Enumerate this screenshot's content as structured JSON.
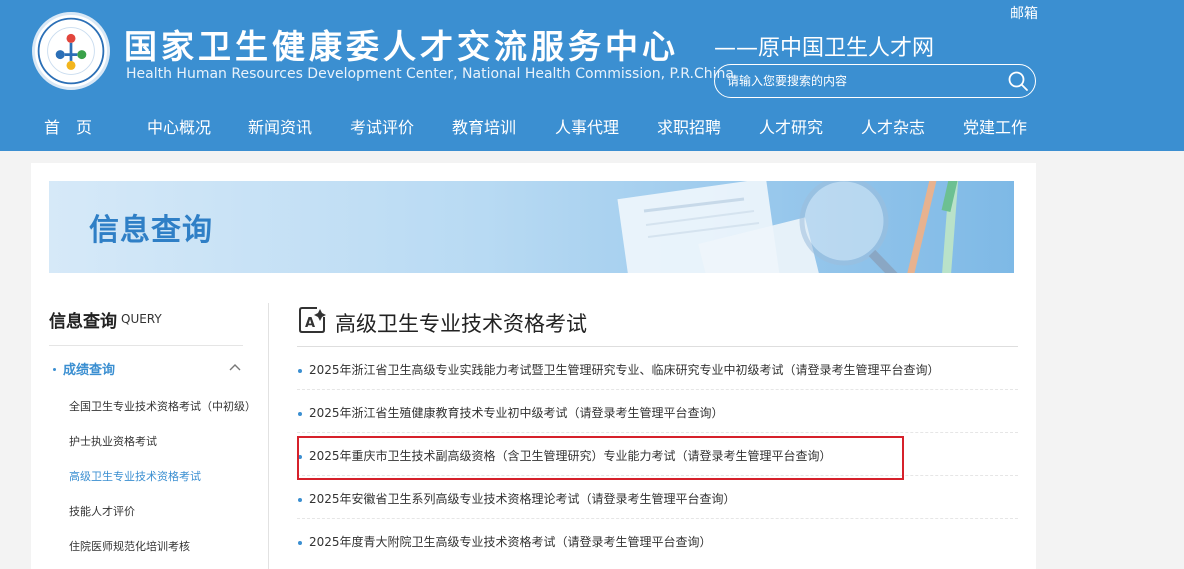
{
  "header": {
    "title": "国家卫生健康委人才交流服务中心",
    "subtitle_en": "Health Human Resources Development Center, National Health Commission, P.R.China",
    "slogan": "——原中国卫生人才网",
    "mail_label": "邮箱",
    "search": {
      "placeholder": "请输入您要搜索的内容",
      "value": ""
    }
  },
  "nav": {
    "items": [
      {
        "label": "首　页"
      },
      {
        "label": "中心概况"
      },
      {
        "label": "新闻资讯"
      },
      {
        "label": "考试评价"
      },
      {
        "label": "教育培训"
      },
      {
        "label": "人事代理"
      },
      {
        "label": "求职招聘"
      },
      {
        "label": "人才研究"
      },
      {
        "label": "人才杂志"
      },
      {
        "label": "党建工作"
      }
    ]
  },
  "banner": {
    "title": "信息查询"
  },
  "sidebar": {
    "title": "信息查询",
    "title_en": "QUERY",
    "group": {
      "label": "成绩查询",
      "expanded": true
    },
    "items": [
      {
        "label": "全国卫生专业技术资格考试（中初级）",
        "active": false
      },
      {
        "label": "护士执业资格考试",
        "active": false
      },
      {
        "label": "高级卫生专业技术资格考试",
        "active": true
      },
      {
        "label": "技能人才评价",
        "active": false
      },
      {
        "label": "住院医师规范化培训考核",
        "active": false
      }
    ]
  },
  "content": {
    "title": "高级卫生专业技术资格考试",
    "articles": [
      {
        "text": "2025年浙江省卫生高级专业实践能力考试暨卫生管理研究专业、临床研究专业中初级考试（请登录考生管理平台查询）"
      },
      {
        "text": "2025年浙江省生殖健康教育技术专业初中级考试（请登录考生管理平台查询）"
      },
      {
        "text": "2025年重庆市卫生技术副高级资格（含卫生管理研究）专业能力考试（请登录考生管理平台查询）"
      },
      {
        "text": "2025年安徽省卫生系列高级专业技术资格理论考试（请登录考生管理平台查询）"
      },
      {
        "text": "2025年度青大附院卫生高级专业技术资格考试（请登录考生管理平台查询）"
      }
    ],
    "highlighted_index": 2
  },
  "colors": {
    "header_bg": "#3b8fd1",
    "accent": "#3b8fd1",
    "highlight_border": "#d6212b"
  },
  "icons": {
    "search": "search-icon",
    "chevron": "chevron-up-icon",
    "content_heading": "edit-text-icon",
    "logo": "logo-emblem"
  }
}
